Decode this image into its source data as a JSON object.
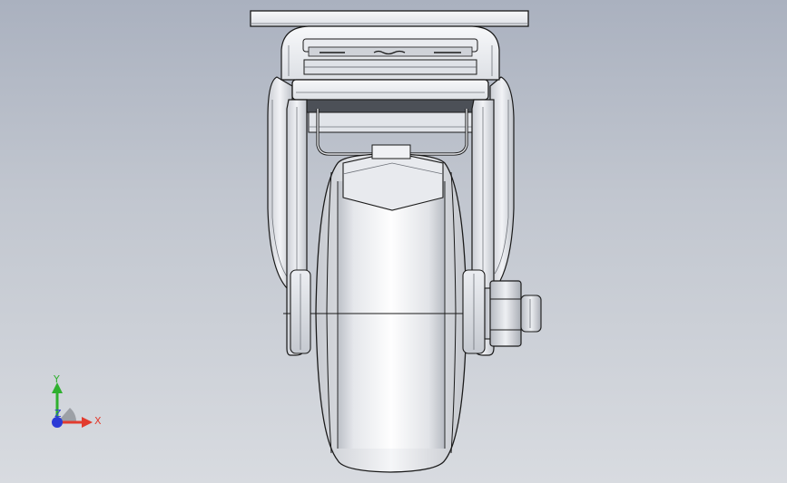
{
  "view": {
    "model_name": "caster-wheel-assembly"
  },
  "triad": {
    "x_label": "X",
    "y_label": "Y",
    "z_label": "Z",
    "colors": {
      "x": "#e23b2e",
      "y": "#2fb02f",
      "z": "#2b3ad6"
    }
  },
  "colors": {
    "background_top": "#aab1bf",
    "background_bottom": "#d8dbe0",
    "part_light": "#f4f5f8",
    "part_mid": "#d5d8de",
    "part_dark": "#9ea3ac",
    "edge": "#1a1a1a"
  }
}
